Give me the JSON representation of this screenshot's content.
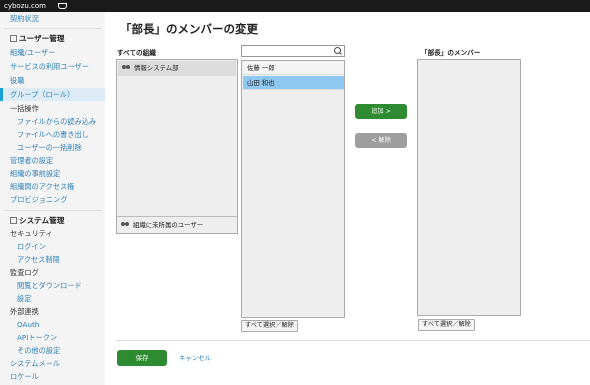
{
  "topbar": {
    "brand": "cybozu.com"
  },
  "sidebar": {
    "items": [
      {
        "label": "契約状況"
      },
      {
        "label": "ユーザー管理"
      },
      {
        "label": "組織/ユーザー"
      },
      {
        "label": "サービスの利用ユーザー"
      },
      {
        "label": "役職"
      },
      {
        "label": "グループ（ロール）"
      },
      {
        "label": "一括操作"
      },
      {
        "label": "ファイルからの読み込み"
      },
      {
        "label": "ファイルへの書き出し"
      },
      {
        "label": "ユーザーの一括削除"
      },
      {
        "label": "管理者の設定"
      },
      {
        "label": "組織の事前設定"
      },
      {
        "label": "組織間のアクセス権"
      },
      {
        "label": "プロビジョニング"
      },
      {
        "label": "システム管理"
      },
      {
        "label": "セキュリティ"
      },
      {
        "label": "ログイン"
      },
      {
        "label": "アクセス制限"
      },
      {
        "label": "監査ログ"
      },
      {
        "label": "閲覧とダウンロード"
      },
      {
        "label": "設定"
      },
      {
        "label": "外部連携"
      },
      {
        "label": "OAuth"
      },
      {
        "label": "APIトークン"
      },
      {
        "label": "その他の設定"
      },
      {
        "label": "システムメール"
      },
      {
        "label": "ロケール"
      }
    ]
  },
  "main": {
    "title": "「部長」のメンバーの変更",
    "org_label": "すべての組織",
    "org_item": "情報システム部",
    "org_bottom": "組織に未所属のユーザー",
    "search_value": "",
    "users": [
      {
        "name": "佐藤 一郎",
        "selected": false
      },
      {
        "name": "山田 和也",
        "selected": true
      }
    ],
    "select_all_users": "すべて選択／解除",
    "add_label": "追加 >",
    "remove_label": "< 解除",
    "members_label": "「部長」のメンバー",
    "select_all_members": "すべて選択／解除",
    "save_label": "保存",
    "cancel_label": "キャンセル"
  },
  "colors": {
    "accent": "#2e8b32",
    "link": "#2c7fb8",
    "selected": "#8ec7f0",
    "topbar": "#1a1a1a"
  }
}
